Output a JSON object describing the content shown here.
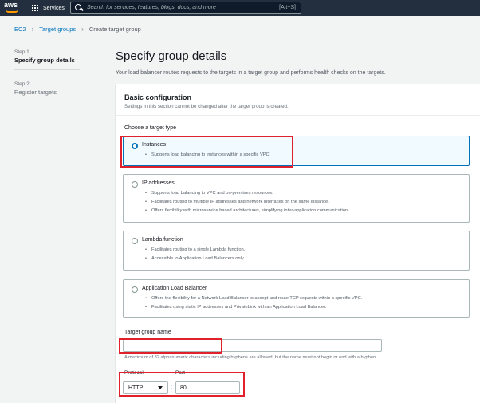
{
  "nav": {
    "logo": "aws",
    "services_label": "Services",
    "search_placeholder": "Search for services, features, blogs, docs, and more",
    "search_shortcut": "[Alt+S]"
  },
  "breadcrumb": {
    "items": [
      "EC2",
      "Target groups",
      "Create target group"
    ]
  },
  "steps": [
    {
      "step": "Step 1",
      "title": "Specify group details"
    },
    {
      "step": "Step 2",
      "title": "Register targets"
    }
  ],
  "page": {
    "title": "Specify group details",
    "description": "Your load balancer routes requests to the targets in a target group and performs health checks on the targets."
  },
  "basic_config": {
    "title": "Basic configuration",
    "subtitle": "Settings in this section cannot be changed after the target group is created.",
    "choose_label": "Choose a target type",
    "target_types": [
      {
        "title": "Instances",
        "selected": true,
        "bullets": [
          "Supports load balancing to instances within a specific VPC."
        ]
      },
      {
        "title": "IP addresses",
        "selected": false,
        "bullets": [
          "Supports load balancing to VPC and on-premises resources.",
          "Facilitates routing to multiple IP addresses and network interfaces on the same instance.",
          "Offers flexibility with microservice based architectures, simplifying inter-application communication."
        ]
      },
      {
        "title": "Lambda function",
        "selected": false,
        "bullets": [
          "Facilitates routing to a single Lambda function.",
          "Accessible to Application Load Balancers only."
        ]
      },
      {
        "title": "Application Load Balancer",
        "selected": false,
        "bullets": [
          "Offers the flexibility for a Network Load Balancer to accept and route TCP requests within a specific VPC.",
          "Facilitates using static IP addresses and PrivateLink with an Application Load Balancer."
        ]
      }
    ],
    "name_label": "Target group name",
    "name_value": "",
    "name_hint": "A maximum of 32 alphanumeric characters including hyphens are allowed, but the name must not begin or end with a hyphen.",
    "protocol_label": "Protocol",
    "protocol_value": "HTTP",
    "port_label": "Port",
    "port_value": "80"
  },
  "colors": {
    "nav_bg": "#232f3e",
    "link": "#0073bb",
    "annotation": "#e0202a",
    "selected_tile_bg": "#f1faff"
  }
}
